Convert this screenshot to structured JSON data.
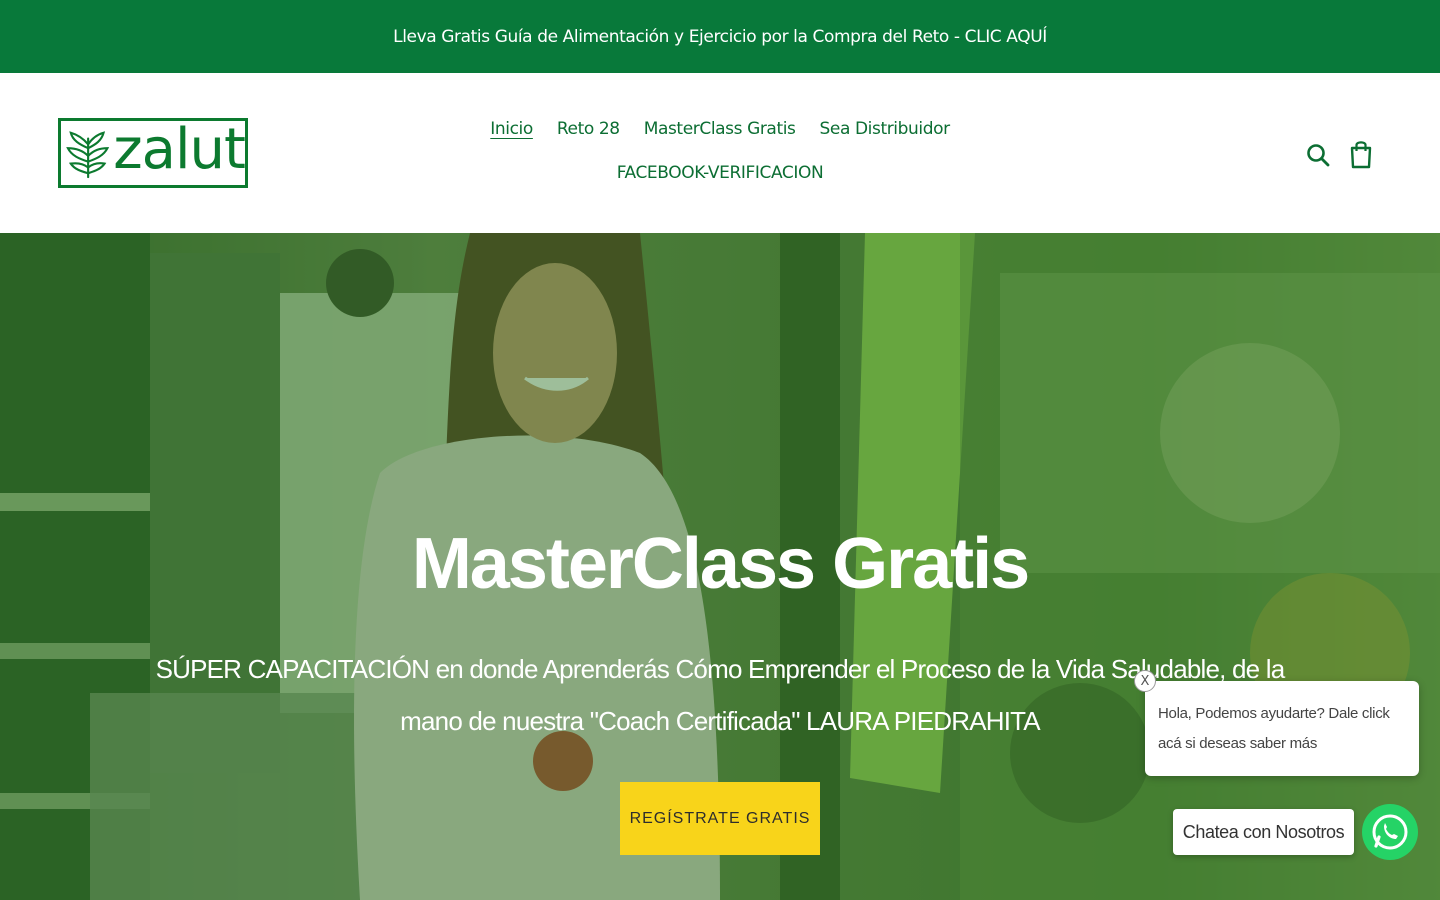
{
  "announcement": {
    "text": "Lleva Gratis Guía de Alimentación y Ejercicio por la Compra del Reto - CLIC AQUÍ"
  },
  "header": {
    "logo_text": "zalut",
    "nav": [
      {
        "label": "Inicio",
        "active": true
      },
      {
        "label": "Reto 28"
      },
      {
        "label": "MasterClass Gratis"
      },
      {
        "label": "Sea Distribuidor"
      },
      {
        "label": "FACEBOOK-VERIFICACION"
      }
    ],
    "icons": {
      "search": "search-icon",
      "cart": "cart-icon"
    }
  },
  "hero": {
    "title": "MasterClass Gratis",
    "subtitle": "SÚPER CAPACITACIÓN en donde Aprenderás Cómo Emprender el Proceso de la Vida Saludable, de la mano de nuestra \"Coach Certificada\" LAURA PIEDRAHITA",
    "cta_label": "REGÍSTRATE GRATIS"
  },
  "chat": {
    "close_label": "X",
    "bubble_text": "Hola, Podemos ayudarte? Dale click acá si deseas saber más",
    "button_label": "Chatea con Nosotros",
    "icon": "whatsapp-icon"
  },
  "colors": {
    "brand_green": "#08793a",
    "cta_yellow": "#f8d41a",
    "whatsapp_green": "#25d366"
  }
}
